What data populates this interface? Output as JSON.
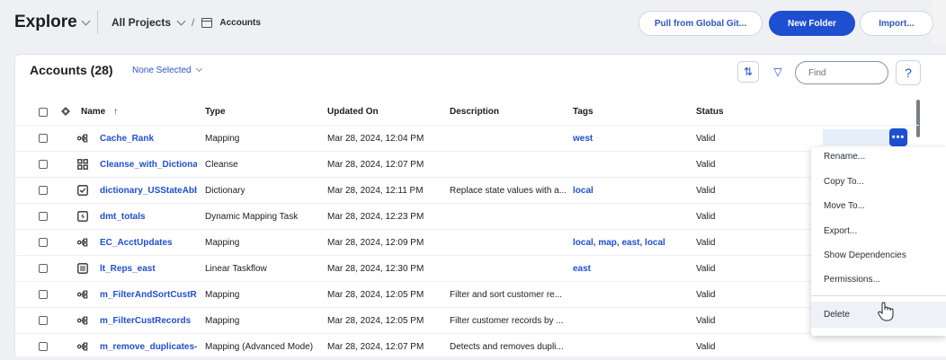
{
  "header": {
    "title": "Explore",
    "breadcrumb_project": "All Projects",
    "breadcrumb_sep": "/",
    "breadcrumb_current": "Accounts",
    "btn_pull": "Pull from Global Git...",
    "btn_new_folder": "New Folder",
    "btn_import": "Import..."
  },
  "panel": {
    "title": "Accounts (28)",
    "selection": "None Selected",
    "find_placeholder": "Find",
    "sort_icon_glyph": "⇅",
    "filter_icon_glyph": "▽",
    "help_glyph": "?"
  },
  "columns": {
    "name": "Name",
    "name_sort_glyph": "↑",
    "type": "Type",
    "updated": "Updated On",
    "description": "Description",
    "tags": "Tags",
    "status": "Status"
  },
  "rows": [
    {
      "icon": "mapping-icon",
      "name": "Cache_Rank",
      "type": "Mapping",
      "updated": "Mar 28, 2024, 12:04 PM",
      "description": "",
      "tags": "west",
      "status": "Valid"
    },
    {
      "icon": "cleanse-icon",
      "name": "Cleanse_with_Dictionar",
      "type": "Cleanse",
      "updated": "Mar 28, 2024, 12:07 PM",
      "description": "",
      "tags": "",
      "status": "Valid"
    },
    {
      "icon": "dictionary-icon",
      "name": "dictionary_USStateAbb",
      "type": "Dictionary",
      "updated": "Mar 28, 2024, 12:11 PM",
      "description": "Replace state values with a...",
      "tags": "local",
      "status": "Valid"
    },
    {
      "icon": "dynamic-mapping-task-icon",
      "name": "dmt_totals",
      "type": "Dynamic Mapping Task",
      "updated": "Mar 28, 2024, 12:23 PM",
      "description": "",
      "tags": "",
      "status": "Valid"
    },
    {
      "icon": "mapping-icon",
      "name": "EC_AcctUpdates",
      "type": "Mapping",
      "updated": "Mar 28, 2024, 12:09 PM",
      "description": "",
      "tags": "local, map, east, local",
      "status": "Valid"
    },
    {
      "icon": "linear-taskflow-icon",
      "name": "lt_Reps_east",
      "type": "Linear Taskflow",
      "updated": "Mar 28, 2024, 12:30 PM",
      "description": "",
      "tags": "east",
      "status": "Valid"
    },
    {
      "icon": "mapping-icon",
      "name": "m_FilterAndSortCustRe",
      "type": "Mapping",
      "updated": "Mar 28, 2024, 12:05 PM",
      "description": "Filter and sort customer re...",
      "tags": "",
      "status": "Valid"
    },
    {
      "icon": "mapping-icon",
      "name": "m_FilterCustRecords",
      "type": "Mapping",
      "updated": "Mar 28, 2024, 12:05 PM",
      "description": "Filter customer records by ...",
      "tags": "",
      "status": "Valid"
    },
    {
      "icon": "mapping-icon",
      "name": "m_remove_duplicates-",
      "type": "Mapping (Advanced Mode)",
      "updated": "Mar 28, 2024, 12:07 PM",
      "description": "Detects and removes dupli...",
      "tags": "",
      "status": "Valid"
    }
  ],
  "row_action_glyph": "•••",
  "context_menu": {
    "items": [
      "Rename...",
      "Copy To...",
      "Move To...",
      "Export...",
      "Show Dependencies",
      "Permissions...",
      "Delete"
    ]
  },
  "colors": {
    "primary": "#1f4fd1",
    "link": "#1f4fd1",
    "background": "#eef0f3"
  }
}
